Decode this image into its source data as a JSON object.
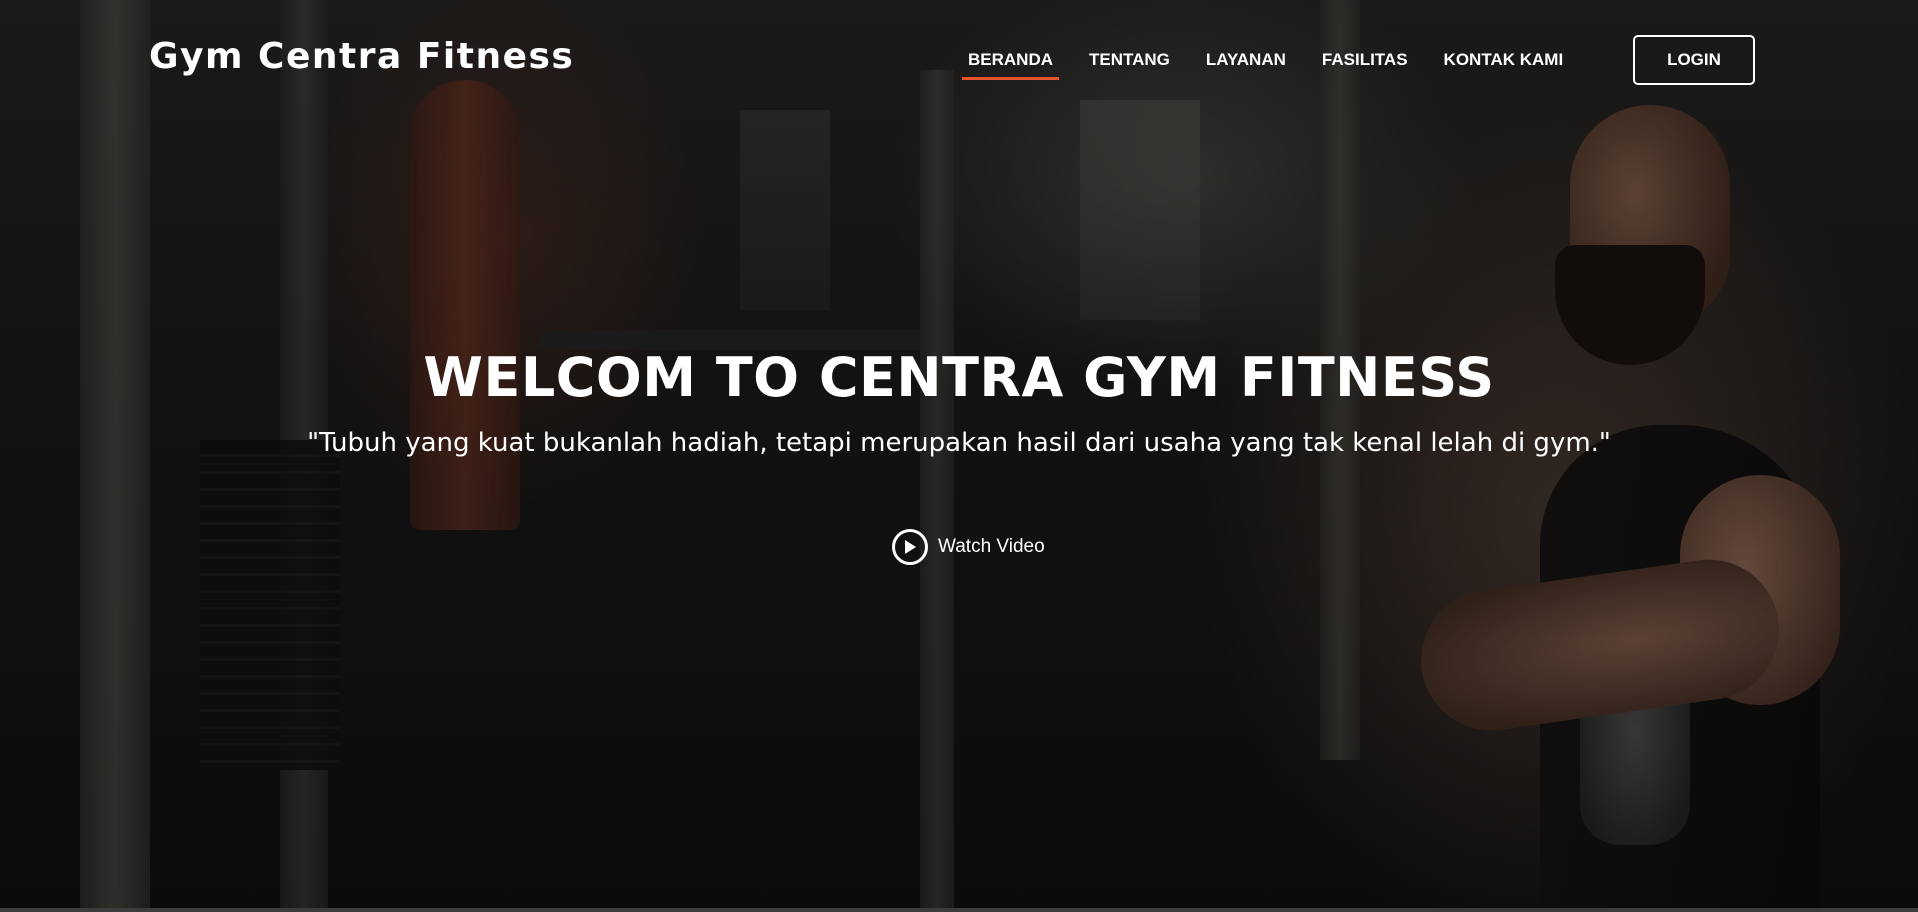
{
  "header": {
    "logo": "Gym Centra Fitness",
    "nav": [
      {
        "label": "BERANDA",
        "active": true
      },
      {
        "label": "TENTANG",
        "active": false
      },
      {
        "label": "LAYANAN",
        "active": false
      },
      {
        "label": "FASILITAS",
        "active": false
      },
      {
        "label": "KONTAK KAMI",
        "active": false
      }
    ],
    "login_label": "LOGIN"
  },
  "hero": {
    "title": "WELCOM TO CENTRA GYM FITNESS",
    "quote": "\"Tubuh yang kuat bukanlah hadiah, tetapi merupakan hasil dari usaha yang tak kenal lelah di gym.\"",
    "watch_video_label": "Watch Video",
    "watch_video_icon": "play-circle-icon"
  },
  "colors": {
    "accent": "#e8532a",
    "text": "#ffffff"
  }
}
